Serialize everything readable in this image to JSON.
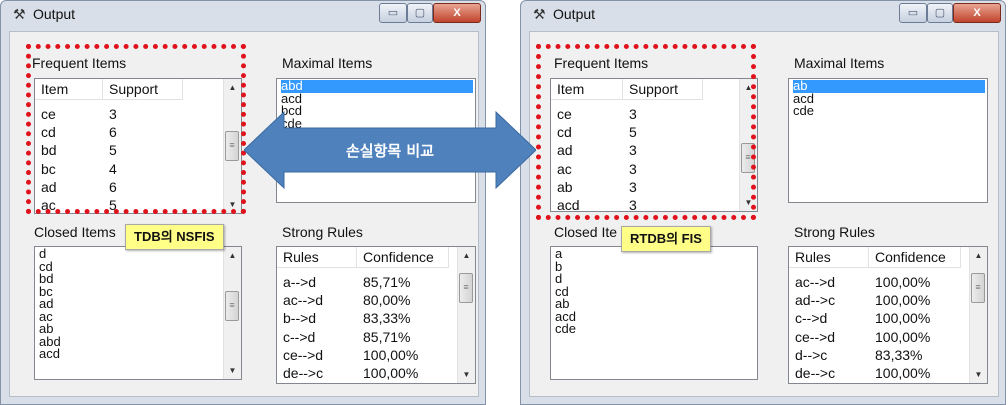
{
  "windows": {
    "left": {
      "title": "Output",
      "buttons": {
        "min": "▭",
        "max": "▢",
        "close": "X"
      },
      "frequent": {
        "label": "Frequent Items",
        "headers": [
          "Item",
          "Support"
        ],
        "rows": [
          [
            "ce",
            "3"
          ],
          [
            "cd",
            "6"
          ],
          [
            "bd",
            "5"
          ],
          [
            "bc",
            "4"
          ],
          [
            "ad",
            "6"
          ],
          [
            "ac",
            "5"
          ]
        ]
      },
      "maximal": {
        "label": "Maximal Items",
        "items": [
          "abd",
          "acd",
          "bcd",
          "cde"
        ],
        "selected_index": 0
      },
      "closed": {
        "label": "Closed Items",
        "items": [
          "d",
          "cd",
          "bd",
          "bc",
          "ad",
          "ac",
          "ab",
          "abd",
          "acd"
        ]
      },
      "strong": {
        "label": "Strong Rules",
        "headers": [
          "Rules",
          "Confidence"
        ],
        "rows": [
          [
            "a-->d",
            "85,71%"
          ],
          [
            "ac-->d",
            "80,00%"
          ],
          [
            "b-->d",
            "83,33%"
          ],
          [
            "c-->d",
            "85,71%"
          ],
          [
            "ce-->d",
            "100,00%"
          ],
          [
            "de-->c",
            "100,00%"
          ]
        ]
      },
      "tag": "TDB의 NSFIS"
    },
    "right": {
      "title": "Output",
      "buttons": {
        "min": "▭",
        "max": "▢",
        "close": "X"
      },
      "frequent": {
        "label": "Frequent Items",
        "headers": [
          "Item",
          "Support"
        ],
        "rows": [
          [
            "ce",
            "3"
          ],
          [
            "cd",
            "5"
          ],
          [
            "ad",
            "3"
          ],
          [
            "ac",
            "3"
          ],
          [
            "ab",
            "3"
          ],
          [
            "acd",
            "3"
          ]
        ]
      },
      "maximal": {
        "label": "Maximal Items",
        "items": [
          "ab",
          "acd",
          "cde"
        ],
        "selected_index": 0
      },
      "closed": {
        "label": "Closed Ite",
        "items": [
          "a",
          "b",
          "d",
          "cd",
          "ab",
          "acd",
          "cde"
        ]
      },
      "strong": {
        "label": "Strong Rules",
        "headers": [
          "Rules",
          "Confidence"
        ],
        "rows": [
          [
            "ac-->d",
            "100,00%"
          ],
          [
            "ad-->c",
            "100,00%"
          ],
          [
            "c-->d",
            "100,00%"
          ],
          [
            "ce-->d",
            "100,00%"
          ],
          [
            "d-->c",
            "83,33%"
          ],
          [
            "de-->c",
            "100,00%"
          ]
        ]
      },
      "tag": "RTDB의 FIS"
    }
  },
  "arrow_label": "손실항목 비교",
  "colors": {
    "arrow": "#4f81bd",
    "highlight": "#e0121b",
    "tag": "#ffff88",
    "selection": "#3399ff"
  }
}
